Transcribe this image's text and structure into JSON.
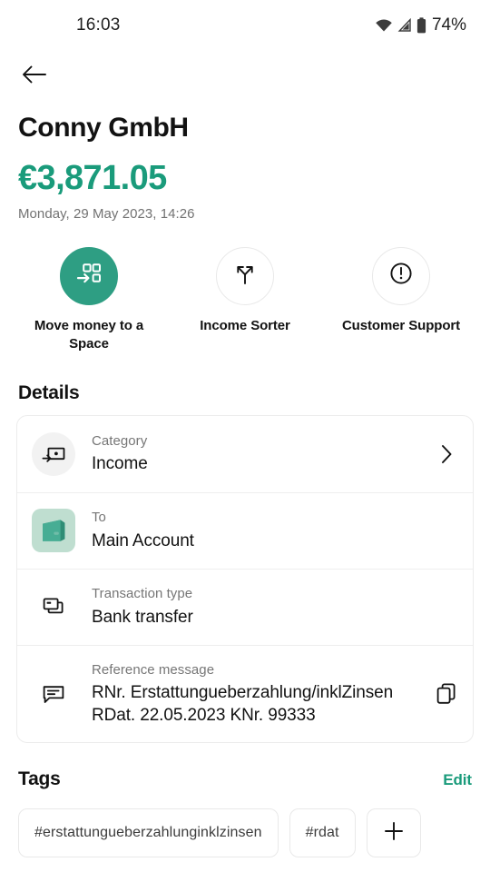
{
  "statusbar": {
    "time": "16:03",
    "battery_percent": "74%",
    "wifi_icon": "wifi-icon",
    "signal_icon": "signal-icon",
    "battery_icon": "battery-icon"
  },
  "nav": {
    "back_icon": "arrow-left-icon"
  },
  "header": {
    "merchant": "Conny GmbH",
    "amount": "€3,871.05",
    "datetime": "Monday, 29 May 2023, 14:26",
    "amount_color": "#1a9b7b"
  },
  "actions": [
    {
      "label": "Move money to a Space",
      "icon": "move-money-grid-arrow-icon",
      "filled": true,
      "fill_color": "#2e9e83"
    },
    {
      "label": "Income Sorter",
      "icon": "split-arrows-icon",
      "filled": false
    },
    {
      "label": "Customer Support",
      "icon": "exclamation-circle-icon",
      "filled": false
    }
  ],
  "details": {
    "title": "Details",
    "rows": [
      {
        "label": "Category",
        "value": "Income",
        "icon": "money-in-icon",
        "trailing_icon": "chevron-right-icon"
      },
      {
        "label": "To",
        "value": "Main Account",
        "icon": "wallet-icon"
      },
      {
        "label": "Transaction type",
        "value": "Bank transfer",
        "icon": "cards-stack-icon"
      },
      {
        "label": "Reference message",
        "value": "RNr. Erstattungueberzahlung/inklZinsen RDat. 22.05.2023 KNr. 99333",
        "icon": "message-bubble-icon",
        "trailing_icon": "copy-icon"
      }
    ]
  },
  "tags": {
    "title": "Tags",
    "edit_label": "Edit",
    "edit_color": "#1a9b7b",
    "chips": [
      "#erstattungueberzahlunginklzinsen",
      "#rdat"
    ],
    "add_icon": "plus-icon"
  }
}
